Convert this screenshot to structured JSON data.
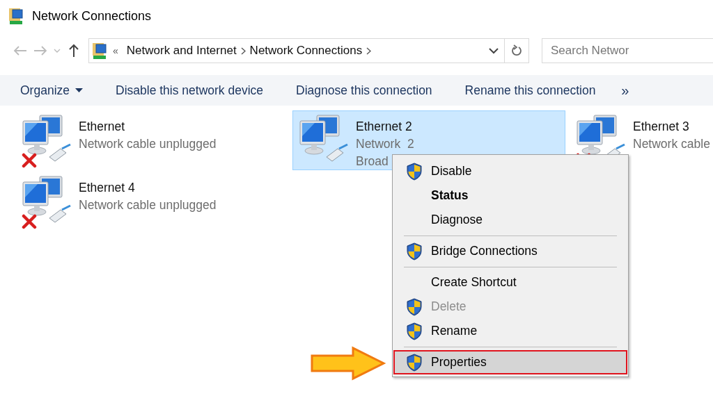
{
  "window": {
    "title": "Network Connections"
  },
  "address": {
    "overflow": "«",
    "crumbs": [
      "Network and Internet",
      "Network Connections"
    ]
  },
  "search": {
    "placeholder": "Search Networ"
  },
  "toolbar": {
    "items": [
      {
        "label": "Organize",
        "dropdown": true
      },
      {
        "label": "Disable this network device",
        "dropdown": false
      },
      {
        "label": "Diagnose this connection",
        "dropdown": false
      },
      {
        "label": "Rename this connection",
        "dropdown": false
      }
    ],
    "more": "»"
  },
  "connections": [
    {
      "name": "Ethernet",
      "lines": [
        "Network cable unplugged"
      ],
      "disconnected": true,
      "selected": false
    },
    {
      "name": "Ethernet 2",
      "lines": [
        "Network  2",
        "Broad"
      ],
      "disconnected": false,
      "selected": true
    },
    {
      "name": "Ethernet 3",
      "lines": [
        "Network cable"
      ],
      "disconnected": true,
      "selected": false
    },
    {
      "name": "Ethernet 4",
      "lines": [
        "Network cable unplugged"
      ],
      "disconnected": true,
      "selected": false
    }
  ],
  "context_menu": {
    "items": [
      {
        "kind": "item",
        "label": "Disable",
        "shield": true,
        "bold": false,
        "disabled": false,
        "selected": false
      },
      {
        "kind": "item",
        "label": "Status",
        "shield": false,
        "bold": true,
        "disabled": false,
        "selected": false
      },
      {
        "kind": "item",
        "label": "Diagnose",
        "shield": false,
        "bold": false,
        "disabled": false,
        "selected": false
      },
      {
        "kind": "separator"
      },
      {
        "kind": "item",
        "label": "Bridge Connections",
        "shield": true,
        "bold": false,
        "disabled": false,
        "selected": false
      },
      {
        "kind": "separator"
      },
      {
        "kind": "item",
        "label": "Create Shortcut",
        "shield": false,
        "bold": false,
        "disabled": false,
        "selected": false
      },
      {
        "kind": "item",
        "label": "Delete",
        "shield": true,
        "bold": false,
        "disabled": true,
        "selected": false
      },
      {
        "kind": "item",
        "label": "Rename",
        "shield": true,
        "bold": false,
        "disabled": false,
        "selected": false
      },
      {
        "kind": "separator"
      },
      {
        "kind": "item",
        "label": "Properties",
        "shield": true,
        "bold": false,
        "disabled": false,
        "selected": true
      }
    ]
  }
}
